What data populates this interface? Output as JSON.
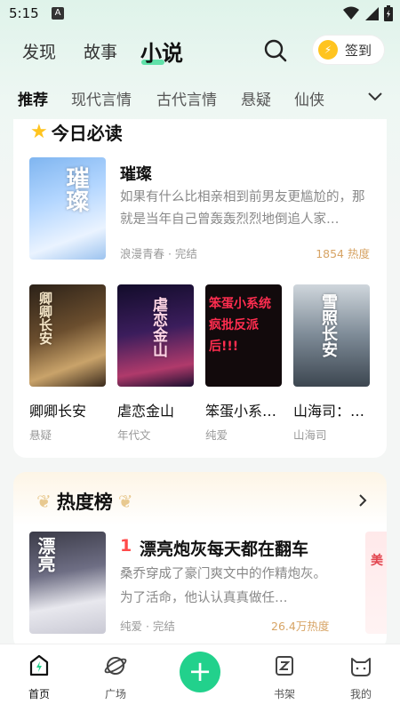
{
  "status": {
    "time": "5:15",
    "a_badge": "A"
  },
  "top_nav": {
    "tabs": [
      "发现",
      "故事",
      "小说"
    ],
    "active": "小说",
    "signin_label": "签到"
  },
  "categories": [
    "推荐",
    "现代言情",
    "古代言情",
    "悬疑",
    "仙侠"
  ],
  "today": {
    "title": "今日必读",
    "featured": {
      "title": "璀璨",
      "desc": "如果有什么比相亲相到前男友更尴尬的，那就是当年自己曾轰轰烈烈地倒追人家…",
      "meta": "浪漫青春 · 完结",
      "heat": "1854 热度",
      "cover_text": "璀璨"
    },
    "books": [
      {
        "title": "卿卿长安",
        "tag": "悬疑",
        "cover_text": "卿卿长安"
      },
      {
        "title": "虐恋金山",
        "tag": "年代文",
        "cover_text": "虐恋金山"
      },
      {
        "title": "笨蛋小系…",
        "tag": "纯爱",
        "cover_text": "笨蛋小系统 疯批反派 后!!!"
      },
      {
        "title": "山海司：…",
        "tag": "山海司",
        "cover_text": "雪照长安"
      }
    ]
  },
  "ranking": {
    "title": "热度榜",
    "rank": "1",
    "book_title": "漂亮炮灰每天都在翻车",
    "desc": "桑乔穿成了豪门爽文中的作精炮灰。为了活命，他认认真真做任…",
    "meta": "纯爱 · 完结",
    "heat": "26.4万热度",
    "cover_text": "漂亮",
    "peek_text": "美"
  },
  "bottom_nav": {
    "items": [
      "首页",
      "广场",
      "书架",
      "我的"
    ],
    "active": "首页"
  },
  "colors": {
    "accent": "#22d18c",
    "rank_red": "#ff4a4a",
    "heat_gold": "#d7a465",
    "star": "#ffc41f"
  }
}
